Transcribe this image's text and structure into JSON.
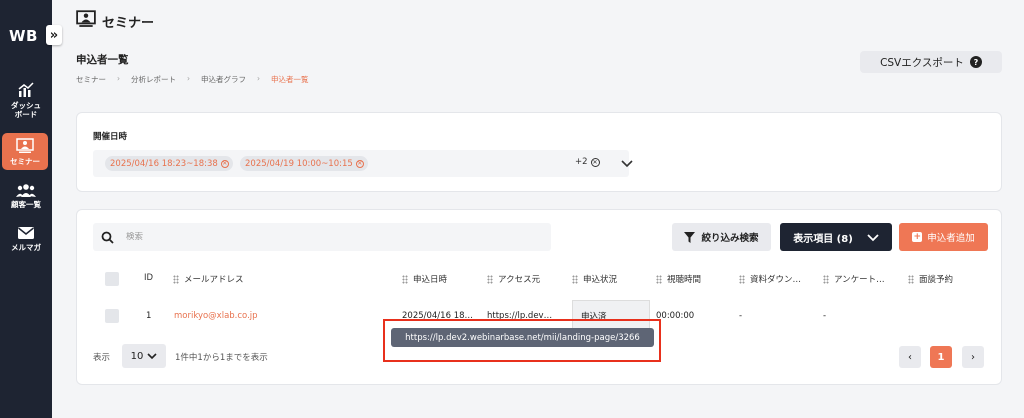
{
  "sidebar": {
    "logo": "WB",
    "collapse_glyph": "»",
    "items": [
      {
        "label_line1": "ダッシュ",
        "label_line2": "ボード",
        "icon": "chart-icon"
      },
      {
        "label_line1": "セミナー",
        "label_line2": "",
        "icon": "seminar-icon",
        "active": true
      },
      {
        "label_line1": "顧客一覧",
        "label_line2": "",
        "icon": "users-icon"
      },
      {
        "label_line1": "メルマガ",
        "label_line2": "",
        "icon": "mail-icon"
      }
    ]
  },
  "header": {
    "title": "セミナー",
    "subtitle": "申込者一覧",
    "breadcrumb": [
      "セミナー",
      "分析レポート",
      "申込者グラフ",
      "申込者一覧"
    ],
    "breadcrumb_sep": "›",
    "csv_export": "CSVエクスポート",
    "help": "?"
  },
  "filter": {
    "label": "開催日時",
    "chips": [
      "2025/04/16 18:23~18:38",
      "2025/04/19 10:00~10:15"
    ],
    "more": "+2"
  },
  "toolbar": {
    "search_placeholder": "検索",
    "filter_button": "絞り込み検索",
    "display_button": "表示項目 (8)",
    "add_button": "申込者追加"
  },
  "table": {
    "columns": [
      "ID",
      "メールアドレス",
      "申込日時",
      "アクセス元",
      "申込状況",
      "視聴時間",
      "資料ダウン…",
      "アンケート…",
      "面談予約"
    ],
    "rows": [
      {
        "id": "1",
        "email": "morikyo@xlab.co.jp",
        "applied_at": "2025/04/16 18…",
        "access_from": "https://lp.dev…",
        "status": "申込済",
        "watch_time": "00:00:00",
        "download": "-",
        "survey": "-",
        "meeting": ""
      }
    ]
  },
  "tooltip": "https://lp.dev2.webinarbase.net/mii/landing-page/3266",
  "footer": {
    "display_label": "表示",
    "per_page": "10",
    "summary": "1件中1から1までを表示",
    "prev": "‹",
    "current_page": "1",
    "next": "›"
  },
  "colors": {
    "accent": "#e8724e",
    "sidebar": "#1e2432",
    "highlight": "#e8301c"
  }
}
